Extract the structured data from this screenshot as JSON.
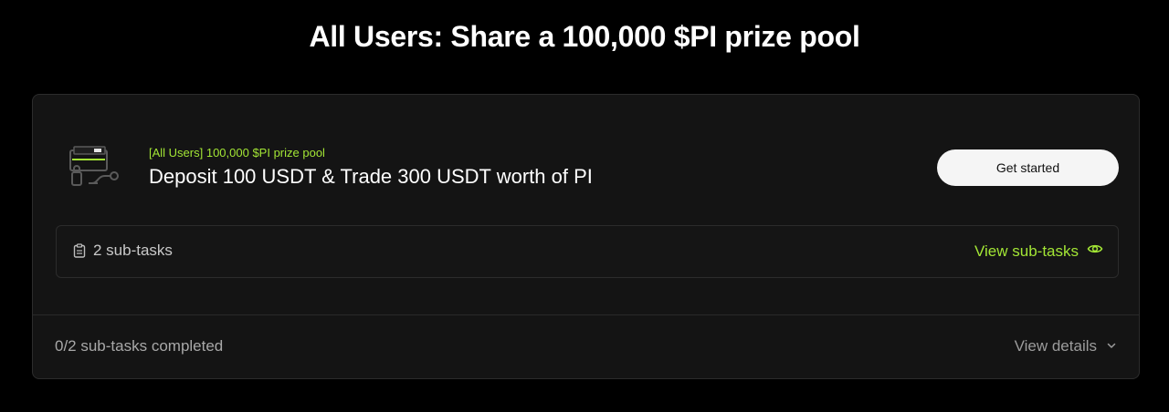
{
  "page": {
    "title": "All Users: Share a 100,000 $PI prize pool"
  },
  "task": {
    "tag": "[All Users] 100,000 $PI prize pool",
    "title": "Deposit 100 USDT & Trade 300 USDT worth of PI",
    "cta_label": "Get started",
    "icon": "wallet-task-icon"
  },
  "subtasks": {
    "count_label": "2 sub-tasks",
    "view_label": "View sub-tasks",
    "icon": "clipboard-icon",
    "view_icon": "eye-icon"
  },
  "footer": {
    "progress_label": "0/2 sub-tasks completed",
    "details_label": "View details",
    "details_icon": "chevron-down-icon"
  },
  "colors": {
    "background": "#000000",
    "card": "#141414",
    "accent": "#a3e635",
    "button_bg": "#f5f5f5"
  }
}
